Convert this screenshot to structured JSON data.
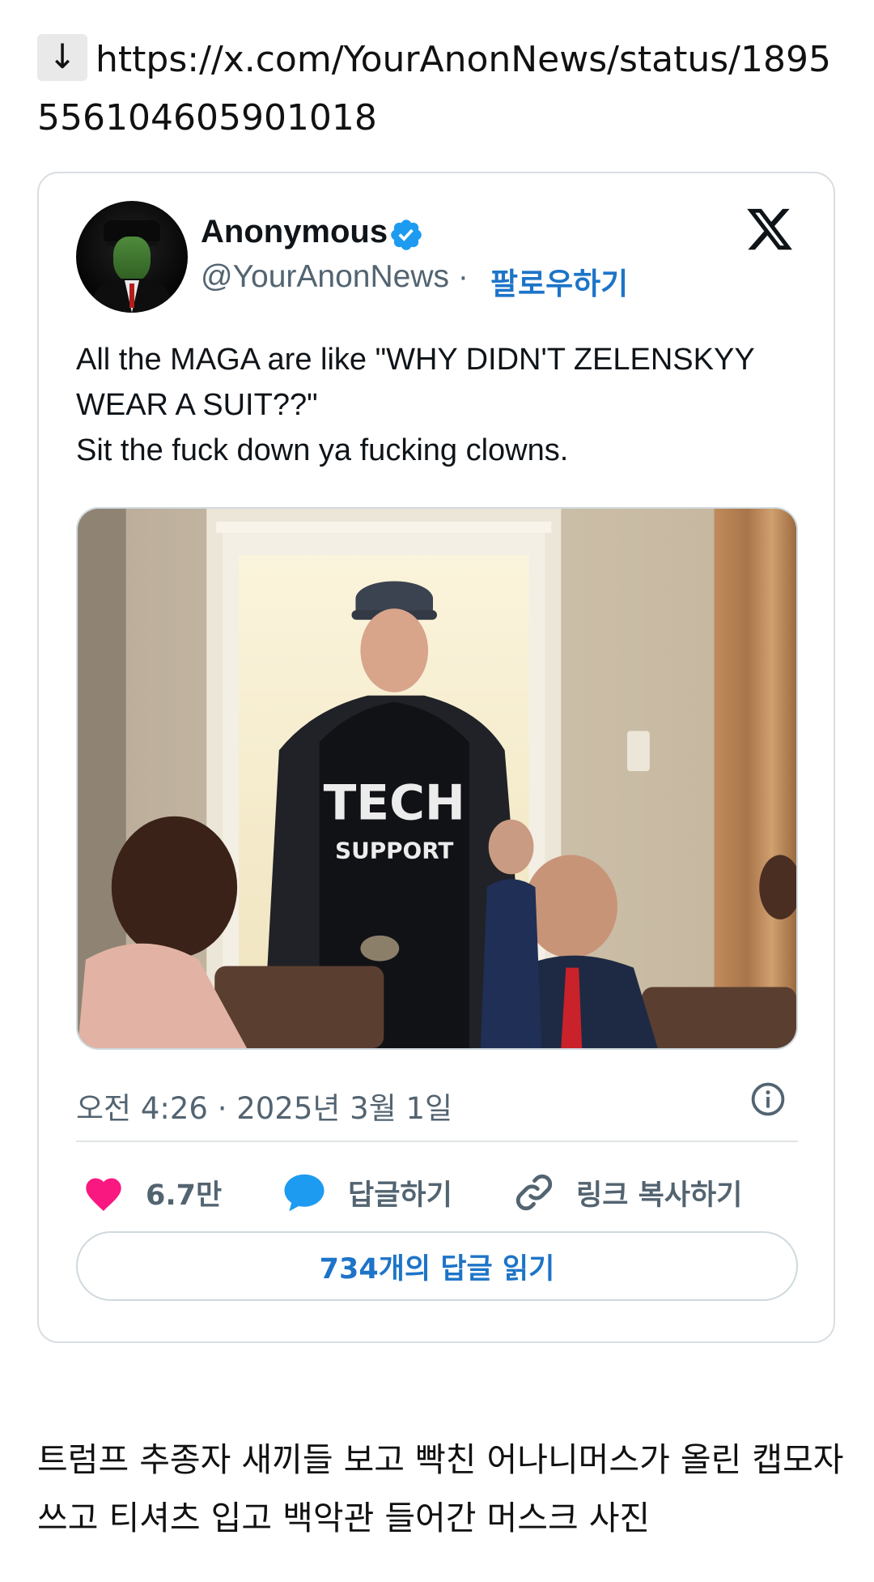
{
  "url": {
    "icon": "download-arrow-icon",
    "glyph": "↓",
    "text": "https://x.com/YourAnonNews/status/1895556104605901018"
  },
  "tweet": {
    "author_name": "Anonymous",
    "handle": "@YourAnonNews",
    "separator": " · ",
    "follow_label": "팔로우하기",
    "text": "All the MAGA are like \"WHY DIDN'T ZELENSKYY WEAR A SUIT??\"\nSit the fuck down ya fucking clowns.",
    "photo_shirt_text_1": "TECH",
    "photo_shirt_text_2": "SUPPORT",
    "timestamp": "오전 4:26 · 2025년 3월 1일",
    "actions": {
      "like_count": "6.7만",
      "reply_label": "답글하기",
      "copy_link_label": "링크 복사하기"
    },
    "read_replies_label": "734개의 답글 읽기",
    "colors": {
      "like": "#f91880",
      "reply": "#1d9bf0",
      "link": "#1d74c8",
      "verified": "#1d9bf0"
    }
  },
  "caption": "트럼프 추종자 새끼들 보고 빡친 어나니머스가 올린 캡모자 쓰고 티셔츠 입고 백악관 들어간 머스크 사진"
}
